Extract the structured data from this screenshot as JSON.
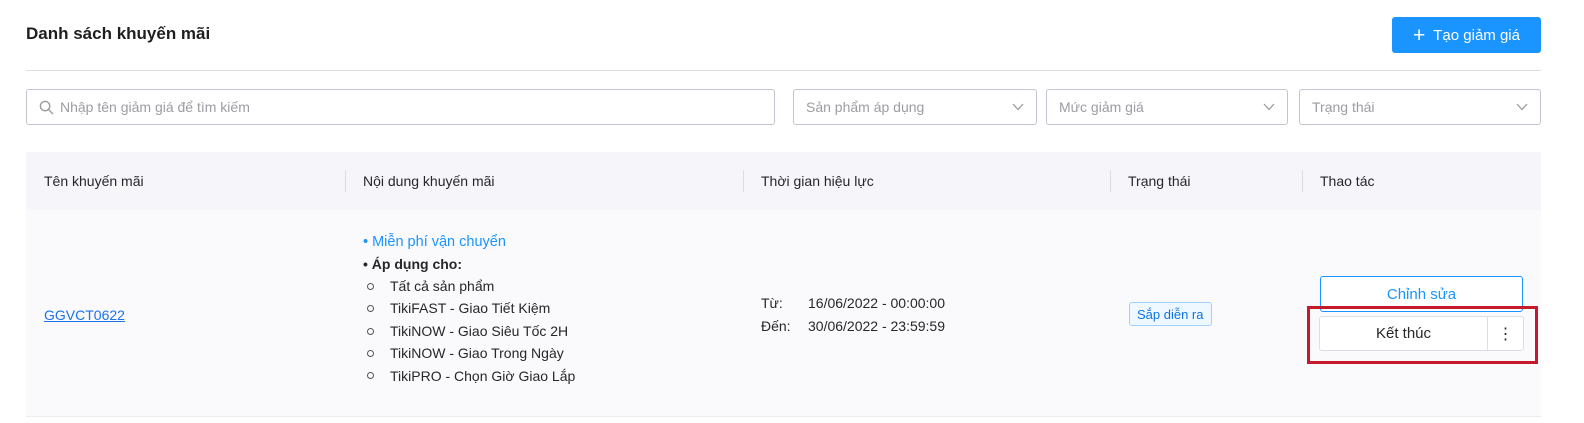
{
  "header": {
    "title": "Danh sách khuyến mãi",
    "create_button": "Tạo giảm giá"
  },
  "filters": {
    "search_placeholder": "Nhập tên giảm giá để tìm kiếm",
    "product_select": "Sản phẩm áp dụng",
    "discount_select": "Mức giảm giá",
    "status_select": "Trạng thái"
  },
  "table": {
    "columns": [
      "Tên khuyến mãi",
      "Nội dung khuyến mãi",
      "Thời gian hiệu lực",
      "Trạng thái",
      "Thao tác"
    ],
    "rows": [
      {
        "code": "GGVCT0622",
        "content_title": "• Miễn phí vận chuyển",
        "applies_label": "• Áp dụng cho:",
        "applies_items": [
          "Tất cả sản phẩm",
          "TikiFAST - Giao Tiết Kiệm",
          "TikiNOW - Giao Siêu Tốc 2H",
          "TikiNOW - Giao Trong Ngày",
          "TikiPRO - Chọn Giờ Giao Lắp"
        ],
        "from_label": "Từ:",
        "from_value": "16/06/2022 - 00:00:00",
        "to_label": "Đến:",
        "to_value": "30/06/2022 - 23:59:59",
        "status": "Sắp diễn ra",
        "edit_button": "Chỉnh sửa",
        "end_button": "Kết thúc",
        "more_icon": "⋮"
      }
    ]
  },
  "colors": {
    "primary": "#1a94ff",
    "highlight": "#c41a2b",
    "header_bg": "#f5f5fa"
  }
}
